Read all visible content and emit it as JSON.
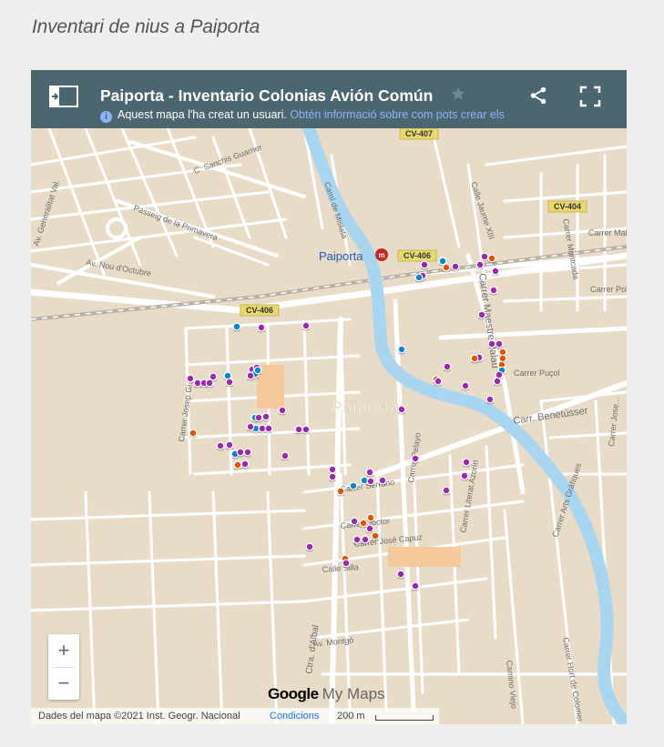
{
  "page": {
    "title": "Inventari de nius a Paiporta"
  },
  "header": {
    "title": "Paiporta - Inventario Colonias Avión Común",
    "info_text": "Aquest mapa l'ha creat un usuari.",
    "info_link": "Obtén informació sobre com pots crear els teus propis mapes."
  },
  "icons": {
    "legend": "legend-toggle-icon",
    "star": "star-icon",
    "share": "share-icon",
    "fullscreen": "fullscreen-icon",
    "info": "info-icon",
    "station": "metro-station-icon"
  },
  "map": {
    "road_labels": [
      {
        "id": "cv407",
        "text": "CV-407"
      },
      {
        "id": "cv406a",
        "text": "CV-406"
      },
      {
        "id": "cv406b",
        "text": "CV-406"
      },
      {
        "id": "cv404",
        "text": "CV-404"
      }
    ],
    "place_labels": [
      {
        "id": "town-station",
        "text": "Paiporta"
      },
      {
        "id": "town-center",
        "text": "Paiporta"
      }
    ],
    "street_labels": [
      {
        "id": "s1",
        "text": "C. Sanchis Guarner"
      },
      {
        "id": "s2",
        "text": "Passeig de la Primavera"
      },
      {
        "id": "s3",
        "text": "Av. Nou d'Octubre"
      },
      {
        "id": "s4",
        "text": "Av. Generalitat Val."
      },
      {
        "id": "s5",
        "text": "Camí de Mislata"
      },
      {
        "id": "s6",
        "text": "Calle Jaume XIII"
      },
      {
        "id": "s7",
        "text": "Carrer Maestre Palau"
      },
      {
        "id": "s8",
        "text": "Carrer Montcada"
      },
      {
        "id": "s9",
        "text": "Carrer Malva"
      },
      {
        "id": "s10",
        "text": "Carrer Polo"
      },
      {
        "id": "s11",
        "text": "Carrer Puçol"
      },
      {
        "id": "s12",
        "text": "Carr. Benetússer"
      },
      {
        "id": "s13",
        "text": "Carrer Josep Gi..."
      },
      {
        "id": "s14",
        "text": "Carrer Pelayo"
      },
      {
        "id": "s15",
        "text": "Carrer Literat Azorín"
      },
      {
        "id": "s16",
        "text": "Carrer Serrano"
      },
      {
        "id": "s17",
        "text": "Carrer Doctor"
      },
      {
        "id": "s18",
        "text": "Carrer José Capuz"
      },
      {
        "id": "s19",
        "text": "Calle Silla"
      },
      {
        "id": "s20",
        "text": "Ctra. d'Albal"
      },
      {
        "id": "s21",
        "text": "Av. Montgó"
      },
      {
        "id": "s22",
        "text": "Carrer Hort de Colomer"
      },
      {
        "id": "s23",
        "text": "Camino Viejo"
      },
      {
        "id": "s24",
        "text": "Carrer Arts Gràfiques"
      },
      {
        "id": "s25",
        "text": "Carrer Jose..."
      }
    ],
    "marker_colors": {
      "purple": "#9c27b0",
      "blue": "#0288d1",
      "orange": "#e65100"
    }
  },
  "controls": {
    "zoom_in": "+",
    "zoom_out": "−"
  },
  "branding": {
    "google": "Google",
    "mymaps": "My Maps"
  },
  "footer": {
    "attribution": "Dades del mapa ©2021 Inst. Geogr. Nacional",
    "terms": "Condicions",
    "scale": "200 m"
  }
}
